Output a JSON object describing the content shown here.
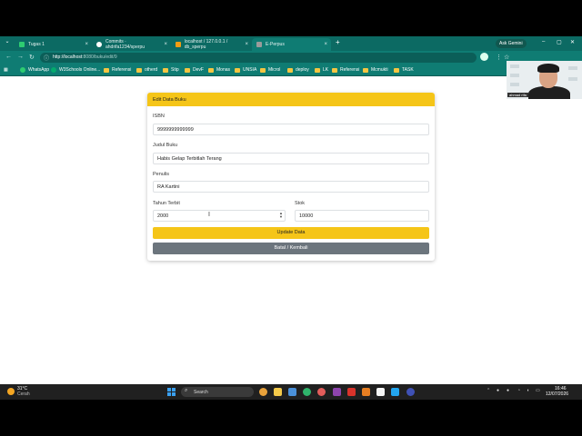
{
  "browser": {
    "tabs": [
      {
        "label": "Tugas 1",
        "color": "#2ecc71",
        "active": false
      },
      {
        "label": "Commits · ahdrifa1234/sperpu",
        "color": "#ffffff",
        "active": false
      },
      {
        "label": "localhost / 127.0.0.1 / db_sperpu",
        "color": "#f39c12",
        "active": false
      },
      {
        "label": "E-Perpus",
        "color": "#9b9b9b",
        "active": true
      }
    ],
    "tab_close": "×",
    "new_tab": "+",
    "ask_gemini": "Ask Gemini",
    "url_host": "http://localhost:",
    "url_rest": "8080/buku/edit/9",
    "bookmarks": [
      {
        "label": "WhatsApp",
        "icon": "whatsapp-icon"
      },
      {
        "label": "W3Schools Online...",
        "icon": "w3schools-icon"
      },
      {
        "label": "Referensi",
        "icon": "folder-icon"
      },
      {
        "label": "otherd",
        "icon": "folder-icon"
      },
      {
        "label": "Stip",
        "icon": "folder-icon"
      },
      {
        "label": "DevF",
        "icon": "folder-icon"
      },
      {
        "label": "Monas",
        "icon": "folder-icon"
      },
      {
        "label": "UNSIA",
        "icon": "folder-icon"
      },
      {
        "label": "Microl",
        "icon": "folder-icon"
      },
      {
        "label": "deploy",
        "icon": "folder-icon"
      },
      {
        "label": "LK",
        "icon": "folder-icon"
      },
      {
        "label": "Referensi",
        "icon": "folder-icon"
      },
      {
        "label": "Mcmukti",
        "icon": "folder-icon"
      },
      {
        "label": "TASK",
        "icon": "folder-icon"
      }
    ]
  },
  "form": {
    "title": "Edit Data Buku",
    "isbn_label": "ISBN",
    "isbn_value": "9999999999999",
    "judul_label": "Judul Buku",
    "judul_value": "Habis Gelap Terbitlah Terang",
    "penulis_label": "Penulis",
    "penulis_value": "RA Kartini",
    "tahun_label": "Tahun Terbit",
    "tahun_value": "2000",
    "stok_label": "Stok",
    "stok_value": "10000",
    "update_button": "Update Data",
    "cancel_button": "Batal / Kembali"
  },
  "webcam": {
    "name": "ahmad rifa"
  },
  "taskbar": {
    "temp": "31°C",
    "weather": "Cerah",
    "search": "Search",
    "time": "16:46",
    "date": "12/07/2026"
  },
  "colors": {
    "accent": "#f5c518",
    "secondary": "#6c757d",
    "chrome": "#0f7c73"
  }
}
